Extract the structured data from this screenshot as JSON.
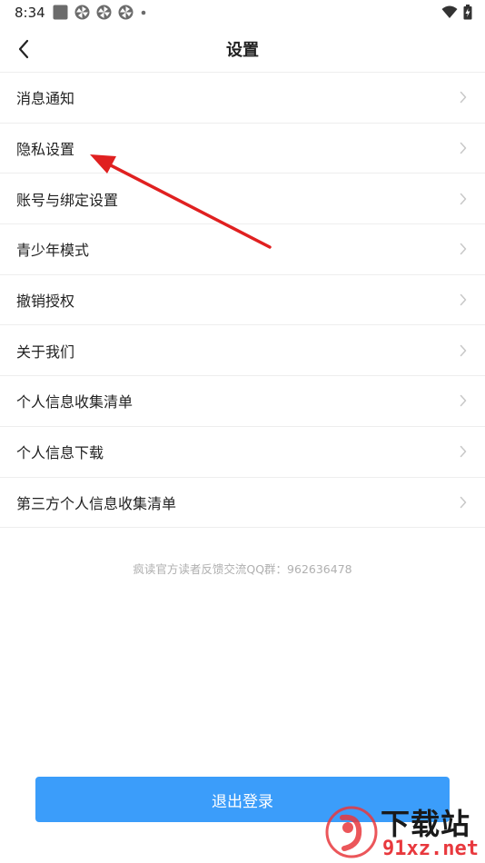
{
  "status_bar": {
    "time": "8:34",
    "notification_icons": [
      "app-square-icon",
      "pinwheel-icon",
      "pinwheel-icon",
      "pinwheel-icon",
      "dot-icon"
    ],
    "system_icons": [
      "wifi-icon",
      "battery-icon"
    ]
  },
  "header": {
    "title": "设置",
    "back_icon": "chevron-left-icon"
  },
  "menu": {
    "items": [
      {
        "label": "消息通知"
      },
      {
        "label": "隐私设置"
      },
      {
        "label": "账号与绑定设置"
      },
      {
        "label": "青少年模式"
      },
      {
        "label": "撤销授权"
      },
      {
        "label": "关于我们"
      },
      {
        "label": "个人信息收集清单"
      },
      {
        "label": "个人信息下载"
      },
      {
        "label": "第三方个人信息收集清单"
      }
    ]
  },
  "feedback_note": "疯读官方读者反馈交流QQ群：962636478",
  "logout_label": "退出登录",
  "watermark": {
    "text": "下载站",
    "url": "91xz.net"
  },
  "colors": {
    "accent": "#3b9dfa",
    "annotation_arrow": "#e02020",
    "divider": "#eeeeee",
    "chevron": "#c8c8c8"
  }
}
